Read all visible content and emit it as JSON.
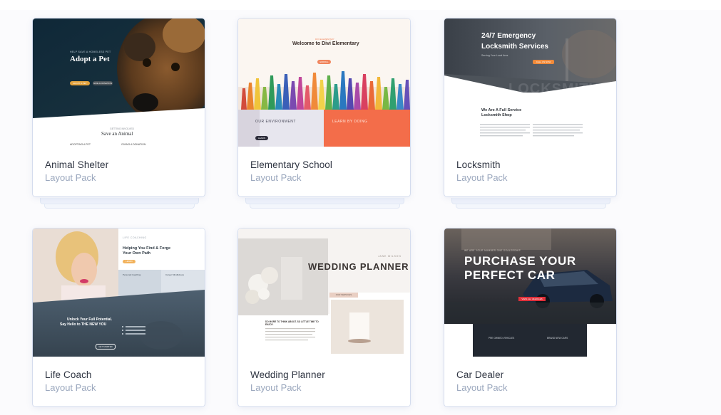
{
  "cards": [
    {
      "title": "Animal Shelter",
      "subtitle": "Layout Pack",
      "preview": {
        "eyebrow": "HELP SAVE A HOMELESS PET",
        "hero_title": "Adopt a Pet",
        "primary_btn": "ADOPT A PET",
        "secondary_btn": "GIVE A DONATION",
        "section_eyebrow": "GETTING INVOLVED",
        "section_title": "Save an Animal",
        "col1": "ADOPTING A PET",
        "col2": "GIVING A DONATION"
      }
    },
    {
      "title": "Elementary School",
      "subtitle": "Layout Pack",
      "preview": {
        "eyebrow": "DIVI ELEMENTARY",
        "hero_title": "Welcome to Divi Elementary",
        "button": "ENROLL",
        "left_label": "OUR ENVIRONMENT",
        "right_label": "LEARN BY DOING",
        "left_btn": "LEARN"
      }
    },
    {
      "title": "Locksmith",
      "subtitle": "Layout Pack",
      "preview": {
        "hero_title_1": "24/7 Emergency",
        "hero_title_2": "Locksmith Services",
        "tagline": "Serving Your Local Area",
        "button": "CALL US NOW",
        "bg_word": "LOCKSMITH",
        "section_title_1": "We Are A Full Service",
        "section_title_2": "Locksmith Shop"
      }
    },
    {
      "title": "Life Coach",
      "subtitle": "Layout Pack",
      "preview": {
        "eyebrow": "LIFE COACHING",
        "hero_title_1": "Helping You Find & Forge",
        "hero_title_2": "Your Own Path",
        "button": "LEARN",
        "col1": "Personal Coaching",
        "col2": "Career Mindfulness",
        "bottom_title_1": "Unlock Your Full Potential.",
        "bottom_title_2": "Say Hello to THE NEW YOU",
        "bottom_btn": "GET STARTED"
      }
    },
    {
      "title": "Wedding Planner",
      "subtitle": "Layout Pack",
      "preview": {
        "eyebrow": "JANE WILSON",
        "hero_title": "WEDDING PLANNER",
        "tag": "OUR SERVICES",
        "body_title": "DO MORE TO THINK ABOUT. SO LITTLE TIME TO ENJOY."
      }
    },
    {
      "title": "Car Dealer",
      "subtitle": "Layout Pack",
      "preview": {
        "eyebrow": "WE ARE YOUR NUMBER ONE DEALERSHIP",
        "hero_title_1": "PURCHASE YOUR",
        "hero_title_2": "PERFECT CAR",
        "button": "VIEW ALL VEHICLES",
        "col1": "PRE OWNED VEHICLES",
        "col2": "BRAND NEW CARS"
      }
    }
  ],
  "colors": {
    "title_text": "#2f3542",
    "subtitle_text": "#9aa7bd",
    "accent_orange": "#f0845c",
    "accent_red": "#e0303a",
    "accent_yellow": "#f2b25c"
  }
}
